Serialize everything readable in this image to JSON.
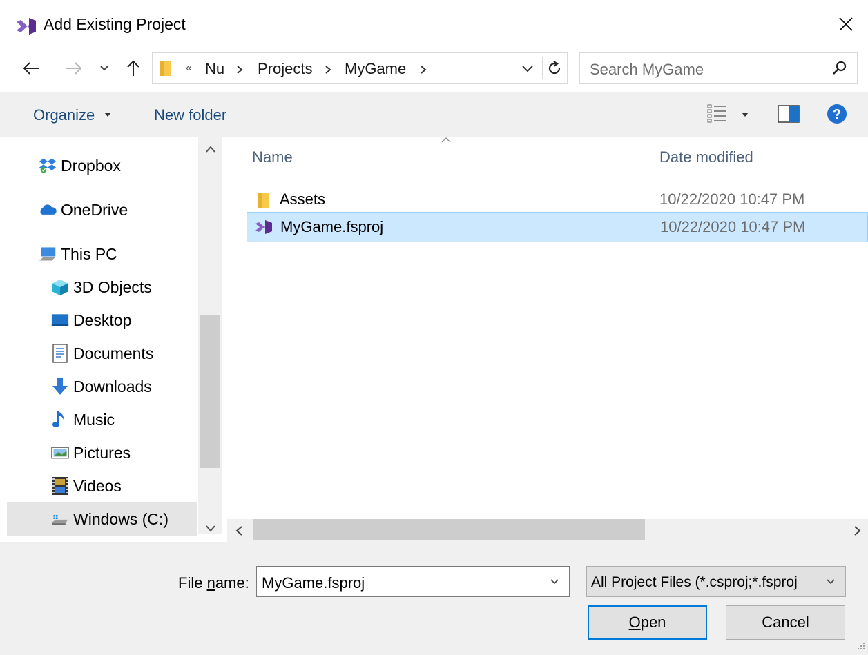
{
  "window": {
    "title": "Add Existing Project"
  },
  "address": {
    "overflow": "«",
    "crumbs": [
      "Nu",
      "Projects",
      "MyGame"
    ]
  },
  "search": {
    "placeholder": "Search MyGame"
  },
  "commandbar": {
    "organize": "Organize",
    "new_folder": "New folder"
  },
  "navigation": {
    "items": [
      {
        "label": "Dropbox",
        "icon": "dropbox-icon"
      },
      {
        "label": "OneDrive",
        "icon": "onedrive-icon"
      },
      {
        "label": "This PC",
        "icon": "this-pc-icon"
      },
      {
        "label": "3D Objects",
        "icon": "3d-objects-icon"
      },
      {
        "label": "Desktop",
        "icon": "desktop-icon"
      },
      {
        "label": "Documents",
        "icon": "documents-icon"
      },
      {
        "label": "Downloads",
        "icon": "downloads-icon"
      },
      {
        "label": "Music",
        "icon": "music-icon"
      },
      {
        "label": "Pictures",
        "icon": "pictures-icon"
      },
      {
        "label": "Videos",
        "icon": "videos-icon"
      },
      {
        "label": "Windows (C:)",
        "icon": "drive-icon"
      }
    ],
    "selected": "Windows (C:)"
  },
  "filelist": {
    "columns": [
      "Name",
      "Date modified"
    ],
    "rows": [
      {
        "name": "Assets",
        "date": "10/22/2020 10:47 PM",
        "icon": "folder-icon"
      },
      {
        "name": "MyGame.fsproj",
        "date": "10/22/2020 10:47 PM",
        "icon": "visual-studio-project-icon",
        "selected": true
      }
    ]
  },
  "footer": {
    "file_name_label_pre": "File ",
    "file_name_label_u": "n",
    "file_name_label_post": "ame:",
    "file_name_value": "MyGame.fsproj",
    "file_type": "All Project Files (*.csproj;*.fsproj",
    "open_u": "O",
    "open_rest": "pen",
    "cancel": "Cancel"
  },
  "colors": {
    "accent": "#0078d7",
    "selection": "#cce8ff",
    "vs_purple": "#68217a"
  }
}
